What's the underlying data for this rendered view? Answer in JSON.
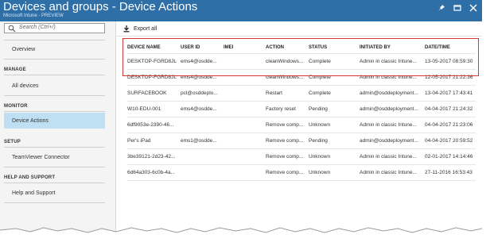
{
  "header": {
    "title": "Devices and groups - Device Actions",
    "subtitle": "Microsoft Intune - PREVIEW",
    "pin_icon": "pin-icon",
    "maximize_icon": "maximize-icon",
    "close_icon": "close-icon"
  },
  "sidebar": {
    "search_placeholder": "Search (Ctrl+/)",
    "overview": "Overview",
    "manage_heading": "MANAGE",
    "all_devices": "All devices",
    "monitor_heading": "MONITOR",
    "device_actions": "Device Actions",
    "setup_heading": "SETUP",
    "teamviewer": "TeamViewer Connector",
    "help_heading": "HELP AND SUPPORT",
    "help_support": "Help and Support"
  },
  "toolbar": {
    "export_label": "Export all"
  },
  "table": {
    "columns": [
      "DEVICE NAME",
      "USER ID",
      "IMEI",
      "ACTION",
      "STATUS",
      "INITIATED BY",
      "DATE/TIME"
    ],
    "rows": [
      [
        "DESKTOP-FGRD8JL",
        "ems4@osdde...",
        "",
        "cleanWindows...",
        "Complete",
        "Admin in classic Intune...",
        "13-05-2017 08:59:30"
      ],
      [
        "DESKTOP-FGRD8JL",
        "ems4@osdde...",
        "",
        "cleanWindows...",
        "Complete",
        "Admin in classic Intune...",
        "12-05-2017 21:22:36"
      ],
      [
        "SURFACEBOOK",
        "pcl@osddeplo...",
        "",
        "Restart",
        "Complete",
        "admin@osddeployment...",
        "13-04-2017 17:43:41"
      ],
      [
        "W10-EDU-001",
        "ems4@osdde...",
        "",
        "Factory reset",
        "Pending",
        "admin@osddeployment...",
        "04-04-2017 21:24:32"
      ],
      [
        "6df9053e-2390-46...",
        "",
        "",
        "Remove comp...",
        "Unknown",
        "Admin in classic Intune...",
        "04-04-2017 21:23:06"
      ],
      [
        "Per's iPad",
        "ems1@osdde...",
        "",
        "Remove comp...",
        "Pending",
        "admin@osddeployment...",
        "04-04-2017 20:59:52"
      ],
      [
        "3be39121-2d23-42...",
        "",
        "",
        "Remove comp...",
        "Unknown",
        "Admin in classic Intune...",
        "02-01-2017 14:14:46"
      ],
      [
        "6d64a303-6c0b-4a...",
        "",
        "",
        "Remove comp...",
        "Unknown",
        "Admin in classic Intune...",
        "27-11-2016 16:53:43"
      ]
    ]
  },
  "colors": {
    "header_bg": "#2f6fa7",
    "active_nav": "#bfe0f3",
    "highlight_border": "#d23a3a"
  }
}
